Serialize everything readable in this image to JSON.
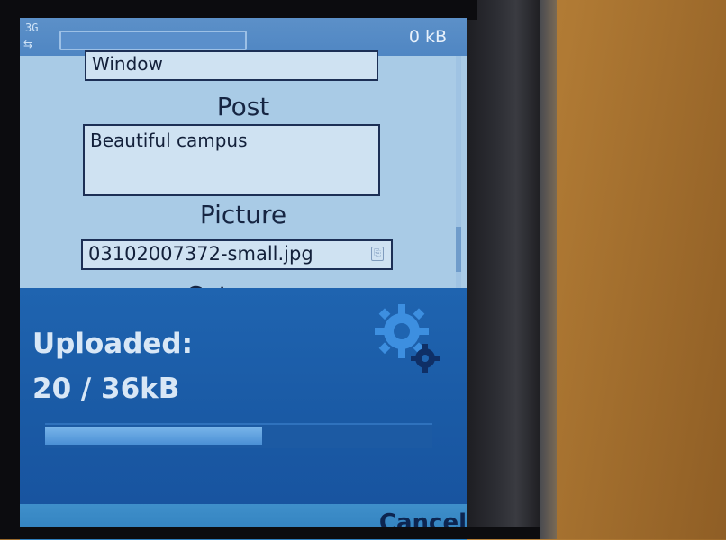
{
  "status": {
    "network": "3G",
    "data_counter": "0 kB"
  },
  "form": {
    "window_value": "Window",
    "post_label": "Post",
    "post_value": "Beautiful campus",
    "picture_label": "Picture",
    "picture_value": "03102007372-small.jpg",
    "category_label": "Category"
  },
  "upload": {
    "title": "Uploaded:",
    "amount": "20 / 36kB",
    "progress": 0.56
  },
  "softkeys": {
    "cancel": "Cancel"
  },
  "colors": {
    "panel": "#1f64b0",
    "progress": "#79b5ea",
    "screen": "#a9cbe6"
  },
  "icons": {
    "busy": "gear-icon",
    "attach": "attachment-icon"
  }
}
